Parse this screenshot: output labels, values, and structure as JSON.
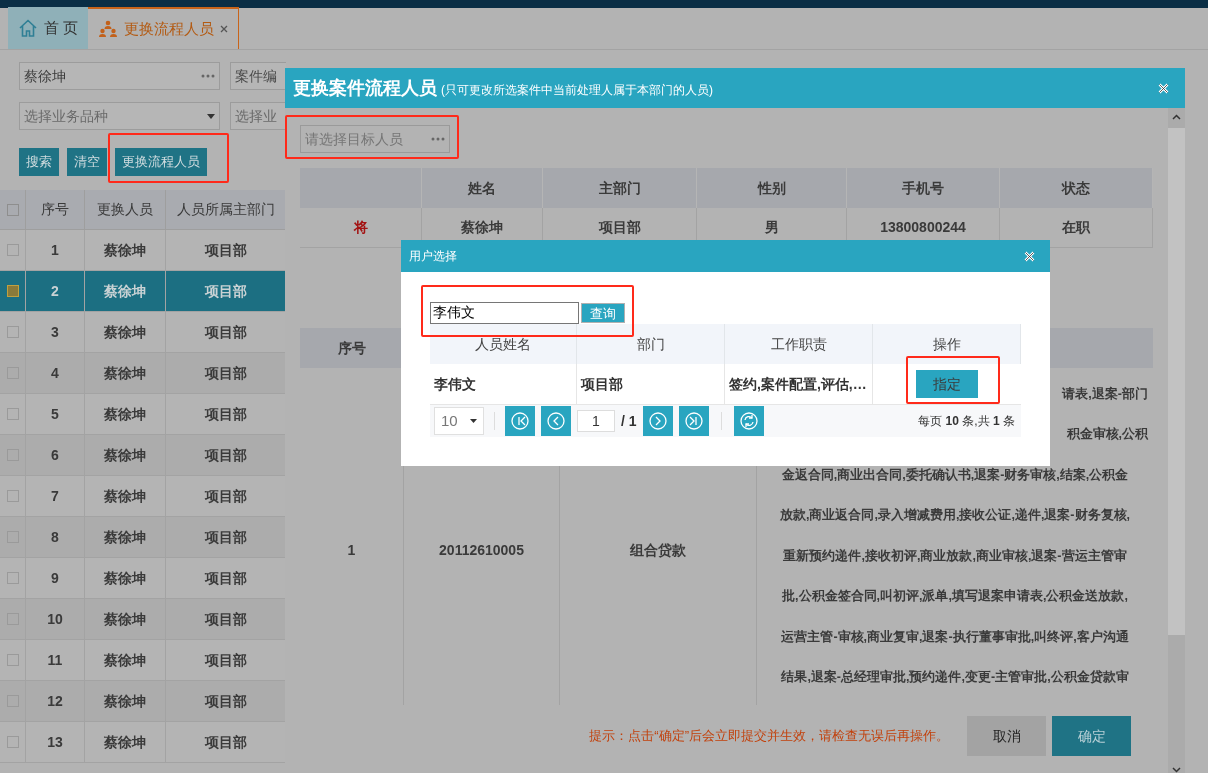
{
  "top_tabs": [
    {
      "label": "首 页",
      "kind": "home",
      "selected": false,
      "closable": false
    },
    {
      "label": "更换流程人员",
      "kind": "flow",
      "selected": true,
      "closable": true
    }
  ],
  "filters": {
    "person": {
      "value": "蔡徐坤"
    },
    "case_no": {
      "placeholder": "案件编"
    },
    "product": {
      "placeholder": "选择业务品种"
    },
    "business": {
      "placeholder": "选择业"
    }
  },
  "filter_buttons": [
    {
      "label": "搜索",
      "highlighted": false
    },
    {
      "label": "清空",
      "highlighted": false
    },
    {
      "label": "更换流程人员",
      "highlighted": true
    }
  ],
  "list": {
    "all_checked": false,
    "columns": [
      "序号",
      "更换人员",
      "人员所属主部门"
    ],
    "rows": [
      {
        "cells": [
          "1",
          "蔡徐坤",
          "项目部"
        ],
        "selected": false,
        "checked": false
      },
      {
        "cells": [
          "2",
          "蔡徐坤",
          "项目部"
        ],
        "selected": true,
        "checked": true
      },
      {
        "cells": [
          "3",
          "蔡徐坤",
          "项目部"
        ],
        "selected": false,
        "checked": false
      },
      {
        "cells": [
          "4",
          "蔡徐坤",
          "项目部"
        ],
        "selected": false,
        "checked": false
      },
      {
        "cells": [
          "5",
          "蔡徐坤",
          "项目部"
        ],
        "selected": false,
        "checked": false
      },
      {
        "cells": [
          "6",
          "蔡徐坤",
          "项目部"
        ],
        "selected": false,
        "checked": false
      },
      {
        "cells": [
          "7",
          "蔡徐坤",
          "项目部"
        ],
        "selected": false,
        "checked": false
      },
      {
        "cells": [
          "8",
          "蔡徐坤",
          "项目部"
        ],
        "selected": false,
        "checked": false
      },
      {
        "cells": [
          "9",
          "蔡徐坤",
          "项目部"
        ],
        "selected": false,
        "checked": false
      },
      {
        "cells": [
          "10",
          "蔡徐坤",
          "项目部"
        ],
        "selected": false,
        "checked": false
      },
      {
        "cells": [
          "11",
          "蔡徐坤",
          "项目部"
        ],
        "selected": false,
        "checked": false
      },
      {
        "cells": [
          "12",
          "蔡徐坤",
          "项目部"
        ],
        "selected": false,
        "checked": false
      },
      {
        "cells": [
          "13",
          "蔡徐坤",
          "项目部"
        ],
        "selected": false,
        "checked": false
      }
    ]
  },
  "modal": {
    "title": "更换案件流程人员",
    "subtitle": "(只可更改所选案件中当前处理人属于本部门的人员)",
    "target_picker": {
      "placeholder": "请选择目标人员",
      "highlighted": true
    },
    "person_table": {
      "columns": [
        "姓名",
        "主部门",
        "性别",
        "手机号",
        "状态"
      ],
      "row": {
        "marker": "将",
        "cells": [
          "蔡徐坤",
          "项目部",
          "男",
          "13800800244",
          "在职"
        ]
      }
    },
    "case_table": {
      "columns": [
        "序号"
      ],
      "row": {
        "cells": [
          "1",
          "20112610005",
          "组合贷款"
        ],
        "task_lines": [
          {
            "text": "请表,退案-部门",
            "kind": "partial"
          },
          {
            "text": "积金审核,公积",
            "kind": "partial"
          },
          {
            "text": "金返合同,商业出合同,委托确认书,退案-财务审核,结案,公积金",
            "kind": "full"
          },
          {
            "text": "放款,商业返合同,录入增减费用,接收公证,递件,退案-财务复核,",
            "kind": "full"
          },
          {
            "text": "重新预约递件,接收初评,商业放款,商业审核,退案-营运主管审",
            "kind": "full"
          },
          {
            "text": "批,公积金签合同,叫初评,派单,填写退案申请表,公积金送放款,",
            "kind": "full"
          },
          {
            "text": "运营主管-审核,商业复审,退案-执行董事审批,叫终评,客户沟通",
            "kind": "full"
          },
          {
            "text": "结果,退案-总经理审批,预约递件,变更-主管审批,公积金贷款审",
            "kind": "full"
          }
        ]
      }
    },
    "hint": "提示：点击“确定”后会立即提交并生效，请检查无误后再操作。",
    "buttons": [
      {
        "label": "取消",
        "kind": "secondary"
      },
      {
        "label": "确定",
        "kind": "primary"
      }
    ]
  },
  "user_dialog": {
    "title": "用户选择",
    "search": {
      "value": "李伟文",
      "button": "查询",
      "highlighted": true
    },
    "columns": [
      "人员姓名",
      "部门",
      "工作职责",
      "操作"
    ],
    "rows": [
      {
        "cells": [
          "李伟文",
          "项目部",
          "签约,案件配置,评估,…"
        ],
        "action": "指定",
        "action_highlighted": true
      }
    ],
    "pagination": {
      "page_size": "10",
      "page": "1",
      "total_pages": "/ 1",
      "summary": "每页 **10** 条,共 **1** 条"
    }
  }
}
